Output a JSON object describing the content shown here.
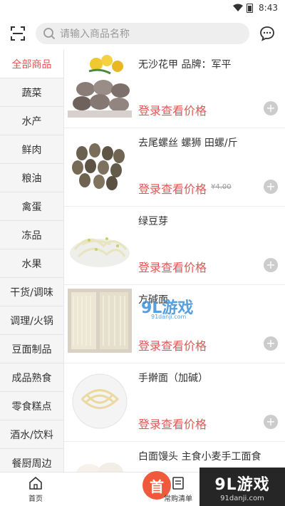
{
  "status": {
    "time": "8:43"
  },
  "search": {
    "placeholder": "请输入商品名称"
  },
  "sidebar": {
    "items": [
      {
        "label": "全部商品",
        "active": true
      },
      {
        "label": "蔬菜"
      },
      {
        "label": "水产"
      },
      {
        "label": "鲜肉"
      },
      {
        "label": "粮油"
      },
      {
        "label": "禽蛋"
      },
      {
        "label": "冻品"
      },
      {
        "label": "水果"
      },
      {
        "label": "干货/调味"
      },
      {
        "label": "调理/火锅"
      },
      {
        "label": "豆面制品"
      },
      {
        "label": "成品熟食"
      },
      {
        "label": "零食糕点"
      },
      {
        "label": "酒水/饮料"
      },
      {
        "label": "餐厨周边"
      }
    ]
  },
  "products": [
    {
      "name": "无沙花甲  品牌：军平",
      "price_label": "登录查看价格",
      "old_price": ""
    },
    {
      "name": "去尾螺丝 螺狮 田螺/斤",
      "price_label": "登录查看价格",
      "old_price": "¥4.00"
    },
    {
      "name": "绿豆芽",
      "price_label": "登录查看价格",
      "old_price": ""
    },
    {
      "name": "方碱面",
      "price_label": "登录查看价格",
      "old_price": ""
    },
    {
      "name": "手擀面（加碱）",
      "price_label": "登录查看价格",
      "old_price": ""
    },
    {
      "name": "白面馒头 主食小麦手工面食",
      "price_label": "",
      "old_price": ""
    }
  ],
  "tabbar": {
    "home": "首页",
    "center": "首",
    "orders": "常购清单"
  },
  "watermark": {
    "big": "9L游戏",
    "small": "91danji.com",
    "overlay": "9L游戏",
    "overlay_small": "91danji.com"
  },
  "colors": {
    "accent": "#e55454",
    "center_button": "#f05a3c"
  }
}
